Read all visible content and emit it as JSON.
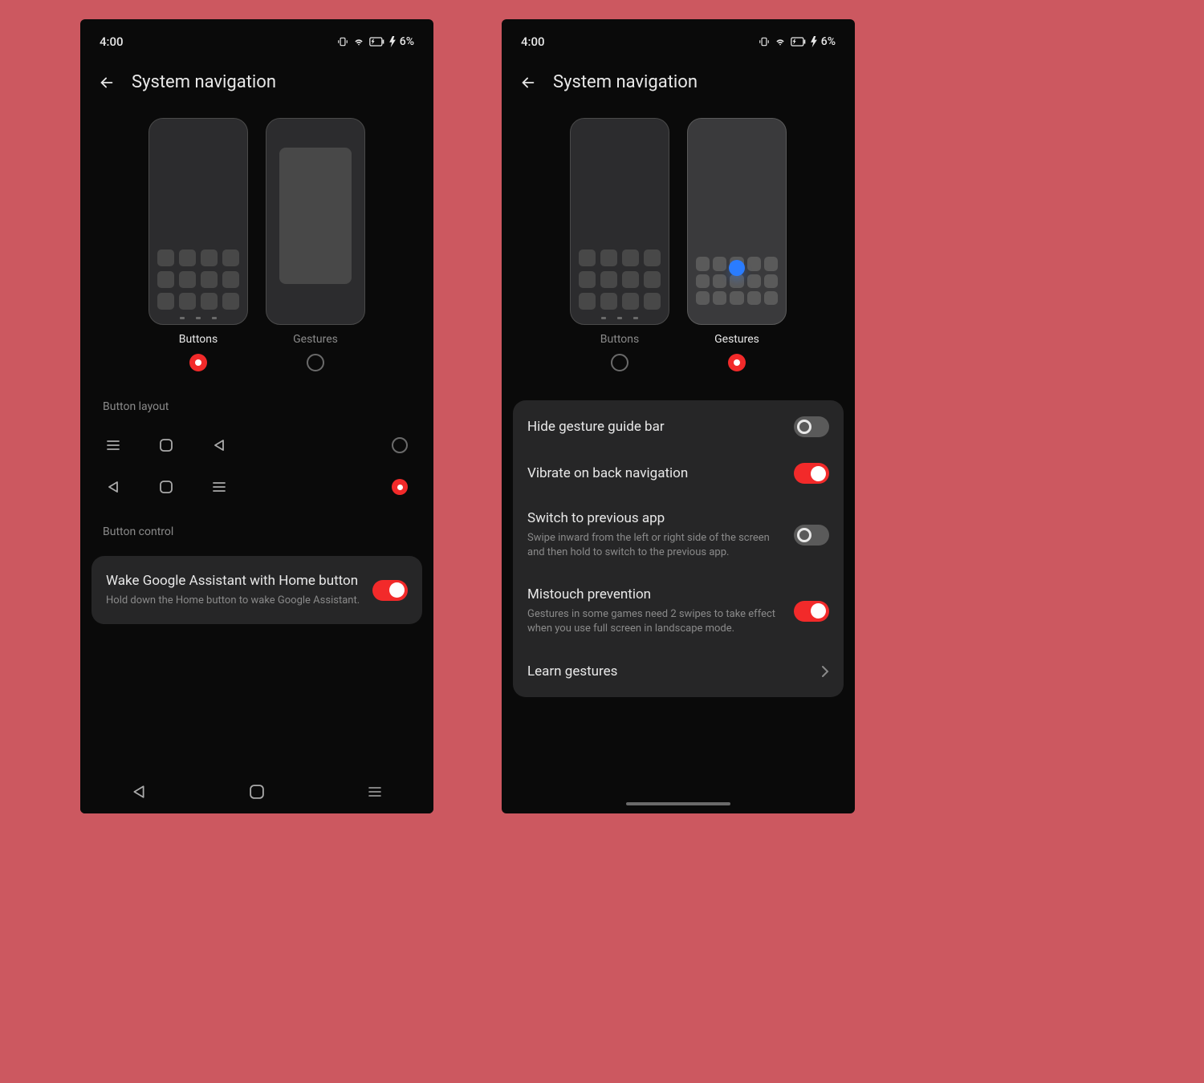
{
  "status": {
    "time": "4:00",
    "battery": "6%"
  },
  "header": {
    "title": "System navigation"
  },
  "nav_options": {
    "buttons": "Buttons",
    "gestures": "Gestures"
  },
  "left": {
    "section_layout": "Button layout",
    "section_control": "Button control",
    "assistant": {
      "title": "Wake Google Assistant with Home button",
      "desc": "Hold down the Home button to wake Google Assistant."
    }
  },
  "right": {
    "hide_bar": {
      "title": "Hide gesture guide bar"
    },
    "vibrate": {
      "title": "Vibrate on back navigation"
    },
    "prev_app": {
      "title": "Switch to previous app",
      "desc": "Swipe inward from the left or right side of the screen and then hold to switch to the previous app."
    },
    "mistouch": {
      "title": "Mistouch prevention",
      "desc": "Gestures in some games need 2 swipes to take effect when you use full screen in landscape mode."
    },
    "learn": {
      "title": "Learn gestures"
    }
  }
}
